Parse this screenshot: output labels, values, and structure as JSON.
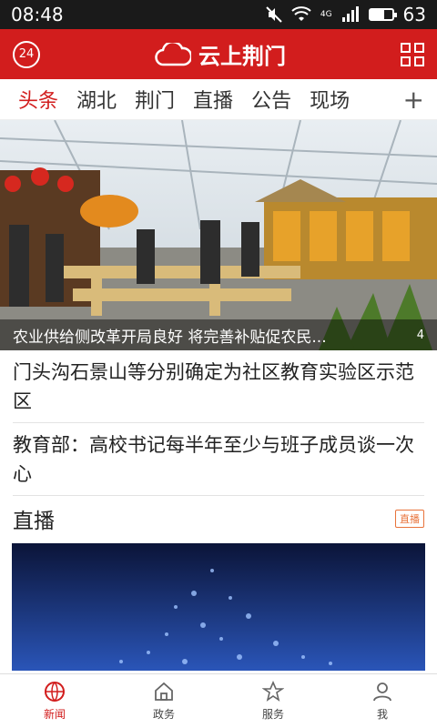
{
  "status": {
    "time": "08:48",
    "network": "4G",
    "battery": "63",
    "battery_level": 0.63
  },
  "app": {
    "badge": "24",
    "title": "云上荆门"
  },
  "tabs": [
    {
      "label": "头条"
    },
    {
      "label": "湖北"
    },
    {
      "label": "荆门"
    },
    {
      "label": "直播"
    },
    {
      "label": "公告"
    },
    {
      "label": "现场"
    }
  ],
  "tab_more": "+",
  "hero": {
    "caption": "农业供给侧改革开局良好 将完善补贴促农民...",
    "count": "4"
  },
  "news": [
    {
      "title": "门头沟石景山等分别确定为社区教育实验区示范区"
    },
    {
      "title": "教育部：高校书记每半年至少与班子成员谈一次心"
    }
  ],
  "live": {
    "title": "直播",
    "badge": "直播"
  },
  "nav": [
    {
      "label": "新闻",
      "icon": "globe-icon"
    },
    {
      "label": "政务",
      "icon": "home-icon"
    },
    {
      "label": "服务",
      "icon": "star-icon"
    },
    {
      "label": "我",
      "icon": "user-icon"
    }
  ],
  "colors": {
    "brand": "#d21d1d",
    "badge": "#e8733b"
  }
}
